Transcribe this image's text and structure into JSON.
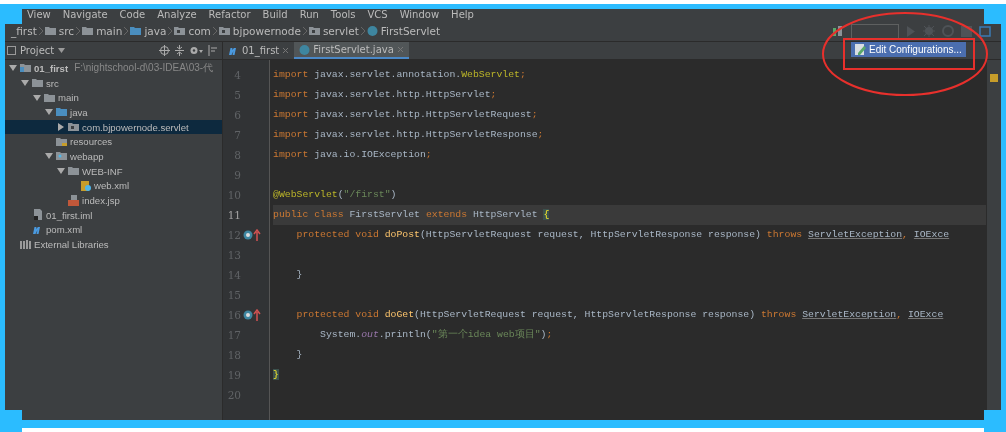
{
  "menu": [
    "View",
    "Navigate",
    "Code",
    "Analyze",
    "Refactor",
    "Build",
    "Run",
    "Tools",
    "VCS",
    "Window",
    "Help"
  ],
  "breadcrumbs": [
    {
      "label": "_first",
      "kind": "none"
    },
    {
      "label": "src",
      "kind": "folder"
    },
    {
      "label": "main",
      "kind": "folder"
    },
    {
      "label": "java",
      "kind": "source"
    },
    {
      "label": "com",
      "kind": "package"
    },
    {
      "label": "bjpowernode",
      "kind": "package"
    },
    {
      "label": "servlet",
      "kind": "package"
    },
    {
      "label": "FirstServlet",
      "kind": "class"
    }
  ],
  "run_popup": {
    "label": "Edit Configurations..."
  },
  "project_panel": {
    "title": "Project",
    "tree": [
      {
        "label": "01_first",
        "path": "F:\\nightschool-d\\03-IDEA\\03-代",
        "kind": "module",
        "expanded": true,
        "selected": false,
        "children": [
          {
            "label": "src",
            "kind": "folder",
            "expanded": true,
            "selected": false,
            "children": [
              {
                "label": "main",
                "kind": "folder",
                "expanded": true,
                "selected": false,
                "children": [
                  {
                    "label": "java",
                    "kind": "source",
                    "expanded": true,
                    "selected": false,
                    "children": [
                      {
                        "label": "com.bjpowernode.servlet",
                        "kind": "package",
                        "expanded": false,
                        "selected": true
                      }
                    ]
                  },
                  {
                    "label": "resources",
                    "kind": "resources",
                    "selected": false
                  },
                  {
                    "label": "webapp",
                    "kind": "web",
                    "expanded": true,
                    "selected": false,
                    "children": [
                      {
                        "label": "WEB-INF",
                        "kind": "folder",
                        "expanded": true,
                        "selected": false,
                        "children": [
                          {
                            "label": "web.xml",
                            "kind": "xml",
                            "selected": false
                          }
                        ]
                      },
                      {
                        "label": "index.jsp",
                        "kind": "jsp",
                        "selected": false
                      }
                    ]
                  }
                ]
              }
            ]
          },
          {
            "label": "01_first.iml",
            "kind": "iml",
            "selected": false
          },
          {
            "label": "pom.xml",
            "kind": "maven",
            "selected": false
          }
        ]
      },
      {
        "label": "External Libraries",
        "kind": "libraries",
        "selected": false
      }
    ]
  },
  "tabs": [
    {
      "label": "01_first",
      "kind": "maven",
      "selected": false
    },
    {
      "label": "FirstServlet.java",
      "kind": "class",
      "selected": true
    }
  ],
  "editor": {
    "lines": [
      {
        "number": "4",
        "current": false,
        "tokens": [
          {
            "kind": "kw",
            "text": "import "
          },
          {
            "kind": "plain",
            "text": "javax.servlet.annotation."
          },
          {
            "kind": "ann",
            "text": "WebServlet"
          },
          {
            "kind": "kw",
            "text": ";"
          }
        ]
      },
      {
        "number": "5",
        "current": false,
        "tokens": [
          {
            "kind": "kw",
            "text": "import "
          },
          {
            "kind": "plain",
            "text": "javax.servlet.http.HttpServlet"
          },
          {
            "kind": "kw",
            "text": ";"
          }
        ]
      },
      {
        "number": "6",
        "current": false,
        "tokens": [
          {
            "kind": "kw",
            "text": "import "
          },
          {
            "kind": "plain",
            "text": "javax.servlet.http.HttpServletRequest"
          },
          {
            "kind": "kw",
            "text": ";"
          }
        ]
      },
      {
        "number": "7",
        "current": false,
        "tokens": [
          {
            "kind": "kw",
            "text": "import "
          },
          {
            "kind": "plain",
            "text": "javax.servlet.http.HttpServletResponse"
          },
          {
            "kind": "kw",
            "text": ";"
          }
        ]
      },
      {
        "number": "8",
        "current": false,
        "tokens": [
          {
            "kind": "kw",
            "text": "import "
          },
          {
            "kind": "plain",
            "text": "java.io.IOException"
          },
          {
            "kind": "kw",
            "text": ";"
          }
        ]
      },
      {
        "number": "9",
        "current": false
      },
      {
        "number": "10",
        "current": false,
        "tokens": [
          {
            "kind": "ann",
            "text": "@WebServlet"
          },
          {
            "kind": "plain",
            "text": "("
          },
          {
            "kind": "str",
            "text": "\"/first\""
          },
          {
            "kind": "plain",
            "text": ")"
          }
        ]
      },
      {
        "number": "11",
        "current": true,
        "tokens": [
          {
            "kind": "kw",
            "text": "public class "
          },
          {
            "kind": "plain",
            "text": "FirstServlet "
          },
          {
            "kind": "kw",
            "text": "extends "
          },
          {
            "kind": "plain",
            "text": "HttpServlet "
          },
          {
            "kind": "brace",
            "text": "{"
          }
        ]
      },
      {
        "number": "12",
        "current": false,
        "override": true,
        "tokens": [
          {
            "kind": "kw",
            "text": "    protected void "
          },
          {
            "kind": "fn",
            "text": "doPost"
          },
          {
            "kind": "plain",
            "text": "(HttpServletRequest request, HttpServletResponse response) "
          },
          {
            "kind": "kw",
            "text": "throws "
          },
          {
            "kind": "link",
            "text": "ServletException"
          },
          {
            "kind": "kw",
            "text": ", "
          },
          {
            "kind": "link",
            "text": "IOExce"
          }
        ]
      },
      {
        "number": "13",
        "current": false
      },
      {
        "number": "14",
        "current": false,
        "tokens": [
          {
            "kind": "plain",
            "text": "    }"
          }
        ]
      },
      {
        "number": "15",
        "current": false
      },
      {
        "number": "16",
        "current": false,
        "override": true,
        "tokens": [
          {
            "kind": "kw",
            "text": "    protected void "
          },
          {
            "kind": "fn",
            "text": "doGet"
          },
          {
            "kind": "plain",
            "text": "(HttpServletRequest request, HttpServletResponse response) "
          },
          {
            "kind": "kw",
            "text": "throws "
          },
          {
            "kind": "link",
            "text": "ServletException"
          },
          {
            "kind": "kw",
            "text": ", "
          },
          {
            "kind": "link",
            "text": "IOExce"
          }
        ]
      },
      {
        "number": "17",
        "current": false,
        "tokens": [
          {
            "kind": "plain",
            "text": "        System."
          },
          {
            "kind": "field",
            "text": "out"
          },
          {
            "kind": "plain",
            "text": ".println("
          },
          {
            "kind": "str",
            "text": "\"第一个idea web项目\""
          },
          {
            "kind": "plain",
            "text": ")"
          },
          {
            "kind": "kw",
            "text": ";"
          }
        ]
      },
      {
        "number": "18",
        "current": false,
        "tokens": [
          {
            "kind": "plain",
            "text": "    }"
          }
        ]
      },
      {
        "number": "19",
        "current": false,
        "tokens": [
          {
            "kind": "brace",
            "text": "}"
          }
        ]
      },
      {
        "number": "20",
        "current": false
      }
    ]
  }
}
